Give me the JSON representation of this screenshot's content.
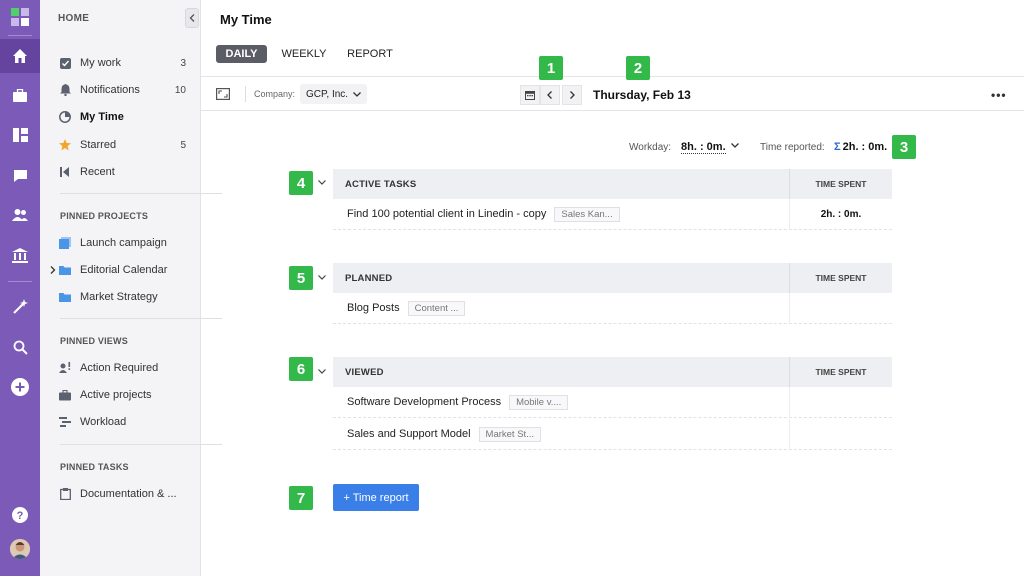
{
  "sidebar": {
    "home_label": "HOME",
    "main_items": [
      {
        "label": "My work",
        "count": "3"
      },
      {
        "label": "Notifications",
        "count": "10"
      },
      {
        "label": "My Time",
        "count": ""
      },
      {
        "label": "Starred",
        "count": "5"
      },
      {
        "label": "Recent",
        "count": ""
      }
    ],
    "pinned_projects_label": "PINNED PROJECTS",
    "pinned_projects": [
      "Launch campaign",
      "Editorial Calendar",
      "Market Strategy"
    ],
    "pinned_views_label": "PINNED VIEWS",
    "pinned_views": [
      "Action Required",
      "Active projects",
      "Workload"
    ],
    "pinned_tasks_label": "PINNED TASKS",
    "pinned_tasks": [
      "Documentation & ..."
    ]
  },
  "page": {
    "title": "My Time",
    "tabs": [
      "DAILY",
      "WEEKLY",
      "REPORT"
    ],
    "company_label": "Company:",
    "company_value": "GCP, Inc.",
    "date": "Thursday, Feb 13",
    "more": "•••",
    "workday_label": "Workday:",
    "workday_value": "8h. : 0m.",
    "time_reported_label": "Time reported:",
    "time_reported_symbol": "Σ",
    "time_reported_value": "2h. : 0m.",
    "time_report_button": "+ Time report"
  },
  "sections": [
    {
      "title": "ACTIVE TASKS",
      "spent_header": "TIME SPENT",
      "rows": [
        {
          "name": "Find 100 potential client in Linedin - copy",
          "tag": "Sales Kan...",
          "spent": "2h. : 0m."
        }
      ]
    },
    {
      "title": "PLANNED",
      "spent_header": "TIME SPENT",
      "rows": [
        {
          "name": "Blog Posts",
          "tag": "Content ...",
          "spent": ""
        }
      ]
    },
    {
      "title": "VIEWED",
      "spent_header": "TIME SPENT",
      "rows": [
        {
          "name": "Software Development Process",
          "tag": "Mobile v....",
          "spent": ""
        },
        {
          "name": "Sales and Support Model",
          "tag": "Market St...",
          "spent": ""
        }
      ]
    }
  ],
  "badges": [
    "1",
    "2",
    "3",
    "4",
    "5",
    "6",
    "7"
  ],
  "colors": {
    "rail": "#7b5ab8",
    "badge": "#33b84a",
    "primary_button": "#3a7ee8",
    "active_tab": "#5a5c66"
  }
}
